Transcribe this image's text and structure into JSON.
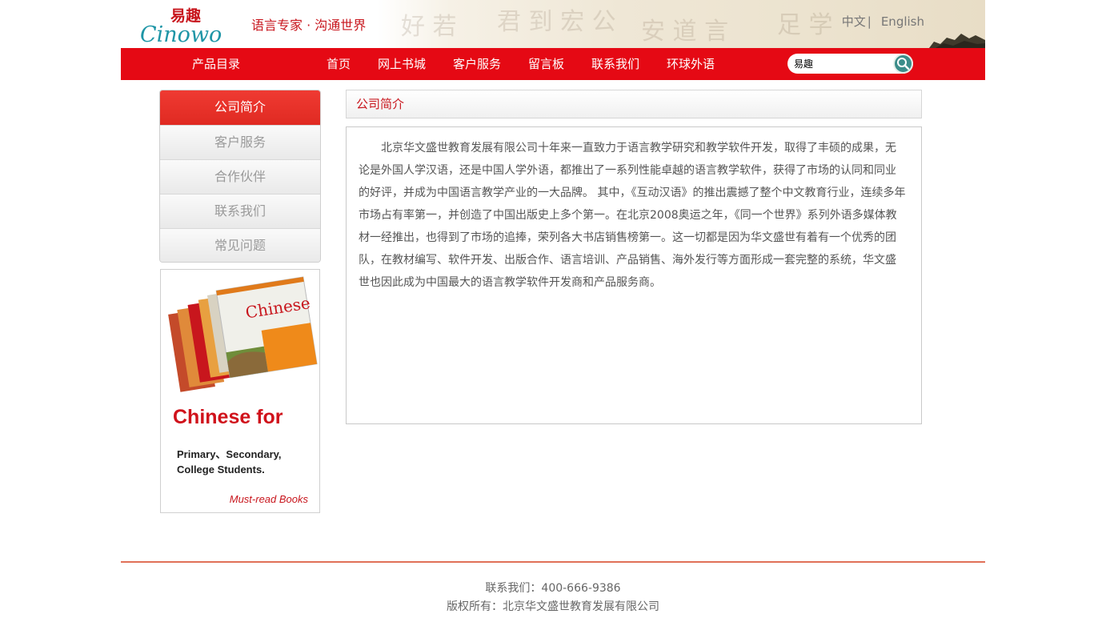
{
  "header": {
    "logo": {
      "cn": "易趣",
      "en": "Cinowo"
    },
    "slogan": "语言专家 · 沟通世界",
    "lang_cn": "中文",
    "lang_sep": "|",
    "lang_en": "English"
  },
  "nav": {
    "catalog": "产品目录",
    "items": [
      "首页",
      "网上书城",
      "客户服务",
      "留言板",
      "联系我们",
      "环球外语"
    ],
    "search_value": "易趣"
  },
  "sidebar": {
    "menu": [
      "公司简介",
      "客户服务",
      "合作伙伴",
      "联系我们",
      "常见问题"
    ],
    "active_index": 0,
    "promo": {
      "title": "Chinese for",
      "line1": "Primary、Secondary,",
      "line2": "College Students.",
      "must": "Must-read Books",
      "book_title": "Chinese"
    }
  },
  "main": {
    "heading": "公司简介",
    "body": "北京华文盛世教育发展有限公司十年来一直致力于语言教学研究和教学软件开发，取得了丰硕的成果，无论是外国人学汉语，还是中国人学外语，都推出了一系列性能卓越的语言教学软件，获得了市场的认同和同业的好评，并成为中国语言教学产业的一大品牌。 其中，《互动汉语》的推出震撼了整个中文教育行业，连续多年市场占有率第一，并创造了中国出版史上多个第一。在北京2008奥运之年，《同一个世界》系列外语多媒体教材一经推出，也得到了市场的追捧，荣列各大书店销售榜第一。这一切都是因为华文盛世有着有一个优秀的团队，在教材编写、软件开发、出版合作、语言培训、产品销售、海外发行等方面形成一套完整的系统，华文盛世也因此成为中国最大的语言教学软件开发商和产品服务商。"
  },
  "footer": {
    "contact": "联系我们：400-666-9386",
    "copyright": "版权所有：北京华文盛世教育发展有限公司"
  },
  "colors": {
    "brand_red": "#e50914",
    "accent_teal": "#3c8d8a"
  },
  "icons": {
    "search": "search-icon",
    "tree": "pine-tree-icon"
  }
}
